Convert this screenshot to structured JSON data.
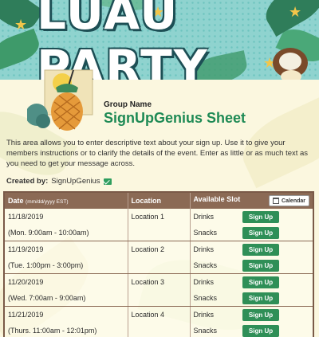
{
  "banner": {
    "title": "LUAU PARTY"
  },
  "header": {
    "group_label": "Group Name",
    "sheet_title": "SignUpGenius Sheet"
  },
  "description": "This area allows you to enter descriptive text about your sign up. Use it to give your members instructions or to clarify the details of the event. Enter as little or as much text as you need to get your message across.",
  "created_by": {
    "label": "Created by:",
    "name": "SignUpGenius"
  },
  "table": {
    "headers": {
      "date": "Date",
      "date_format": "(mm/dd/yyyy EST)",
      "location": "Location",
      "slot": "Available Slot",
      "calendar": "Calendar"
    },
    "rows": [
      {
        "date": "11/18/2019",
        "time": "(Mon. 9:00am - 10:00am)",
        "location": "Location 1",
        "slots": [
          {
            "item": "Drinks",
            "button": "Sign Up"
          },
          {
            "item": "Snacks",
            "button": "Sign Up"
          }
        ]
      },
      {
        "date": "11/19/2019",
        "time": "(Tue. 1:00pm - 3:00pm)",
        "location": "Location 2",
        "slots": [
          {
            "item": "Drinks",
            "button": "Sign Up"
          },
          {
            "item": "Snacks",
            "button": "Sign Up"
          }
        ]
      },
      {
        "date": "11/20/2019",
        "time": "(Wed. 7:00am - 9:00am)",
        "location": "Location 3",
        "slots": [
          {
            "item": "Drinks",
            "button": "Sign Up"
          },
          {
            "item": "Snacks",
            "button": "Sign Up"
          }
        ]
      },
      {
        "date": "11/21/2019",
        "time": "(Thurs. 11:00am - 12:01pm)",
        "location": "Location 4",
        "slots": [
          {
            "item": "Drinks",
            "button": "Sign Up"
          },
          {
            "item": "Snacks",
            "button": "Sign Up"
          }
        ]
      }
    ]
  },
  "colors": {
    "accent_green": "#1e8a55",
    "button_green": "#2f8f57",
    "table_header_brown": "#8b6a55",
    "banner_teal": "#8fd3cf"
  }
}
